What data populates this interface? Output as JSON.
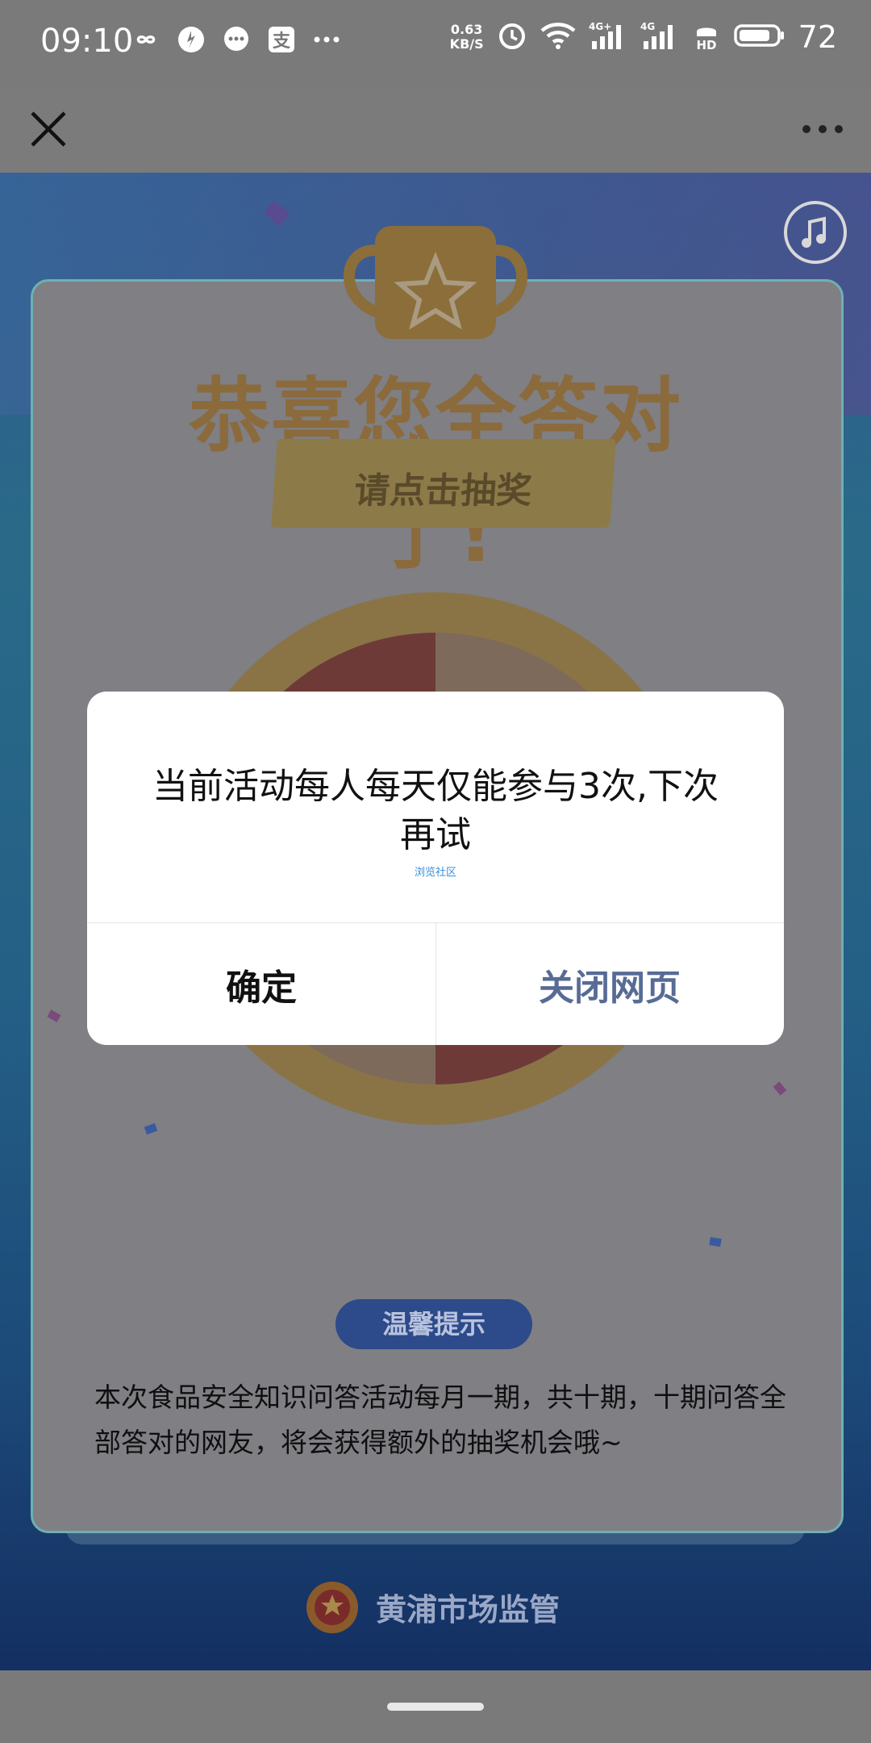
{
  "status_bar": {
    "time": "09:10",
    "net_speed_value": "0.63",
    "net_speed_unit": "KB/S",
    "network_1": "4G+",
    "network_2": "4G",
    "hd": "HD",
    "battery": "72"
  },
  "nav": {
    "close_icon": "close-icon",
    "more_icon": "more-icon"
  },
  "page": {
    "banner_title": "恭喜您全答对了!",
    "banner_subtitle": "请点击抽奖",
    "hint_label": "温馨提示",
    "description": "本次食品安全知识问答活动每月一期，共十期，十期问答全部答对的网友，将会获得额外的抽奖机会哦~",
    "footer_org": "黄浦市场监管"
  },
  "dialog": {
    "message": "当前活动每人每天仅能参与3次,下次再试",
    "source": "浏览社区",
    "ok_label": "确定",
    "close_label": "关闭网页"
  },
  "colors": {
    "dialog_bg": "#ffffff",
    "ok_text": "#111111",
    "close_text": "#576b95"
  }
}
